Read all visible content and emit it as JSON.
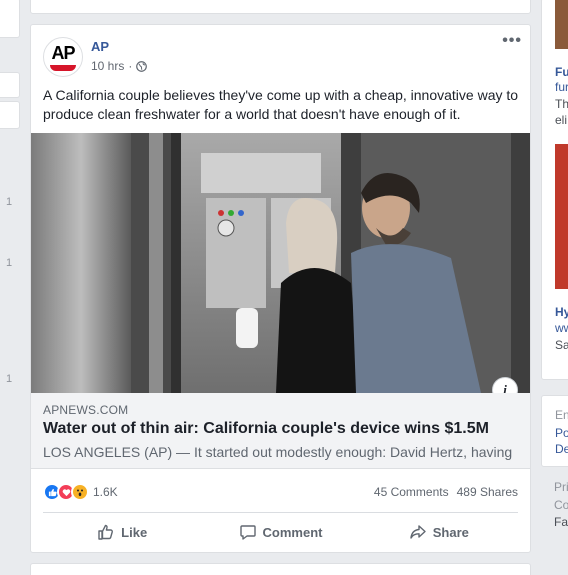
{
  "left_column": {
    "counts": [
      "1",
      "1",
      "1"
    ]
  },
  "post": {
    "page_name": "AP",
    "timestamp": "10 hrs",
    "separator": "·",
    "privacy_icon": "globe-icon",
    "more_icon": "more-options-icon",
    "text": "A California couple believes they've come up with a cheap, innovative way to produce clean freshwater for a world that doesn't have enough of it.",
    "link": {
      "domain": "APNEWS.COM",
      "title": "Water out of thin air: California couple's device wins $1.5M",
      "description": "LOS ANGELES (AP) — It started out modestly enough: David Hertz, having"
    },
    "info_label": "i",
    "reactions": {
      "types": [
        "like",
        "love",
        "wow"
      ],
      "count": "1.6K"
    },
    "comments": "45 Comments",
    "shares": "489 Shares",
    "actions": {
      "like": "Like",
      "comment": "Comment",
      "share": "Share"
    }
  },
  "right_column": {
    "items": [
      {
        "lines": [
          "Fu",
          "fur",
          "Th",
          "eli"
        ]
      },
      {
        "lines": [
          "Hy",
          "ww",
          "Sa"
        ]
      },
      {
        "lines": [
          "En",
          "Po",
          "De"
        ]
      },
      {
        "lines": [
          "Pri",
          "Co",
          "Fa"
        ]
      }
    ]
  },
  "colors": {
    "page_bg": "#e9ebee",
    "link_blue": "#365899",
    "secondary_text": "#606770",
    "like_blue": "#1877f2",
    "love_red": "#f33e58",
    "wow_yellow": "#f7b125"
  }
}
